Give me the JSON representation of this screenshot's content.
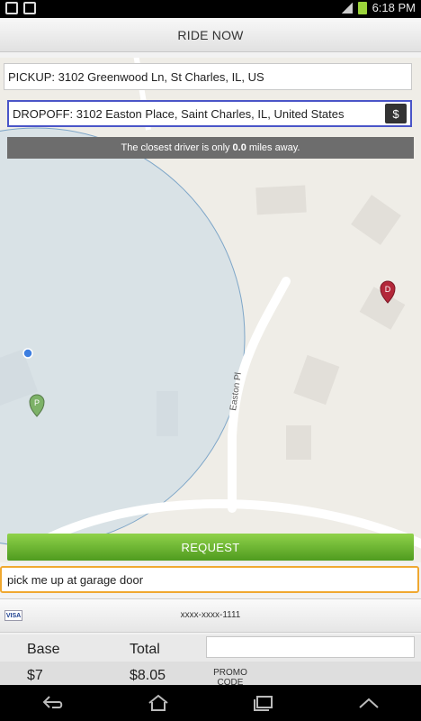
{
  "status_bar": {
    "time": "6:18 PM"
  },
  "header": {
    "title": "RIDE NOW"
  },
  "pickup": {
    "text": "PICKUP: 3102 Greenwood Ln, St Charles, IL, US"
  },
  "dropoff": {
    "text": "DROPOFF: 3102 Easton Place, Saint Charles, IL, United States",
    "icon": "cash-icon"
  },
  "notice": {
    "prefix": "The closest driver is only",
    "distance": "0.0",
    "suffix": "miles away."
  },
  "map": {
    "street_label": "Easton Pl",
    "pin_pickup_letter": "P",
    "pin_dropoff_letter": "D"
  },
  "request": {
    "label": "REQUEST"
  },
  "note": {
    "value": "pick me up at garage door"
  },
  "payment": {
    "card_brand": "VISA",
    "card_number": "xxxx-xxxx-1111"
  },
  "fare": {
    "base_label": "Base",
    "total_label": "Total",
    "base_value": "$7",
    "total_value": "$8.05",
    "promo_label": "PROMO CODE"
  },
  "nav": {
    "back_icon": "back-icon",
    "home_icon": "home-icon",
    "recent_icon": "recent-apps-icon",
    "up_icon": "chevron-up-icon"
  }
}
